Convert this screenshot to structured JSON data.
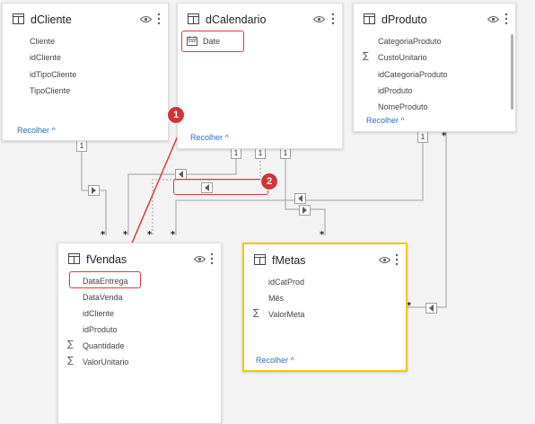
{
  "tables": {
    "dCliente": {
      "title": "dCliente",
      "fields": [
        "Cliente",
        "idCliente",
        "idTipoCliente",
        "TipoCliente"
      ],
      "collapse_label": "Recolher ^"
    },
    "dCalendario": {
      "title": "dCalendario",
      "fields": [
        "Date"
      ],
      "collapse_label": "Recolher ^"
    },
    "dProduto": {
      "title": "dProduto",
      "fields": [
        "CategoriaProduto",
        "CustoUnitario",
        "idCategoriaProduto",
        "idProduto",
        "NomeProduto"
      ],
      "collapse_label": "Recolher ^"
    },
    "fVendas": {
      "title": "fVendas",
      "fields": [
        "DataEntrega",
        "DataVenda",
        "idCliente",
        "idProduto",
        "Quantidade",
        "ValorUnitario"
      ]
    },
    "fMetas": {
      "title": "fMetas",
      "fields": [
        "idCatProd",
        "Mês",
        "ValorMeta"
      ],
      "collapse_label": "Recolher ^"
    }
  },
  "cardinality": {
    "one": "1",
    "many": "*"
  },
  "annotations": {
    "badge1": "1",
    "badge2": "2"
  },
  "colors": {
    "highlight_red": "#e0393e",
    "selected_yellow": "#f2c811",
    "link_blue": "#2b6cc4",
    "badge_red": "#d13438"
  }
}
